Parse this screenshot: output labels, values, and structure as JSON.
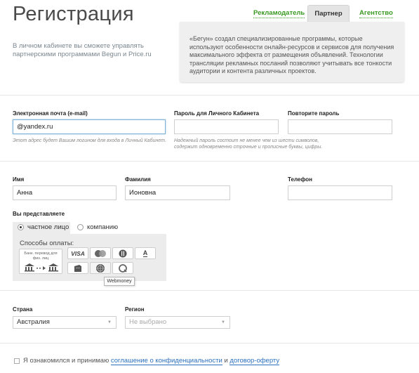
{
  "header": {
    "title": "Регистрация",
    "subtitle": "В личном кабинете вы сможете управлять партнерскими программами Begun и Price.ru",
    "tabs": [
      {
        "label": "Рекламодатель",
        "active": false
      },
      {
        "label": "Партнер",
        "active": true
      },
      {
        "label": "Агентство",
        "active": false
      }
    ],
    "info_text": "«Бегун» создал специализированные программы, которые используют особенности онлайн-ресурсов и сервисов для получения максимального эффекта от размещения объявлений. Технологии трансляции рекламных посланий позволяют учитывать все тонкости аудитории и контента различных проектов."
  },
  "account": {
    "email_label": "Электронная почта (e-mail)",
    "email_value": "@yandex.ru",
    "email_hint": "Этот адрес будет Вашим логином для входа в Личный Кабинет.",
    "password_label": "Пароль для Личного Кабинета",
    "password_value": "",
    "repeat_label": "Повторите пароль",
    "repeat_value": "",
    "password_hint": "Надежный пароль состоит не менее чем из шести символов, содержит одновременно строчные и прописные буквы, цифры."
  },
  "personal": {
    "name_label": "Имя",
    "name_value": "Анна",
    "surname_label": "Фамилия",
    "surname_value": "Ионовна",
    "phone_label": "Телефон",
    "phone_value": ""
  },
  "represent": {
    "label": "Вы представляете",
    "options": [
      {
        "label": "частное лицо",
        "selected": true
      },
      {
        "label": "компанию",
        "selected": false
      }
    ]
  },
  "payment": {
    "title": "Способы оплаты:",
    "bank_text": "Банк. перевод для физ. лиц",
    "methods": [
      "VISA",
      "",
      "",
      "A"
    ],
    "tooltip": "Webmoney"
  },
  "location": {
    "country_label": "Страна",
    "country_value": "Австралия",
    "region_label": "Регион",
    "region_value": "Не выбрано"
  },
  "agreement": {
    "prefix": "Я ознакомился и принимаю",
    "link1": "соглашение о конфиденциальности",
    "middle": "и",
    "link2": "договор-оферту"
  },
  "colors": {
    "tab_link": "#3a9a22",
    "link": "#2a6fbd",
    "focus_border": "#7fb2d8"
  }
}
